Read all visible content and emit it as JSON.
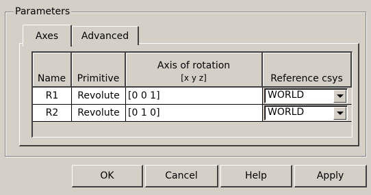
{
  "group": {
    "title": "Parameters"
  },
  "tabs": [
    {
      "label": "Axes",
      "active": true
    },
    {
      "label": "Advanced",
      "active": false
    }
  ],
  "table": {
    "headers": {
      "name": "Name",
      "primitive": "Primitive",
      "axis": "Axis of rotation",
      "axis_sub": "[x y z]",
      "ref": "Reference csys"
    },
    "rows": [
      {
        "name": "R1",
        "primitive": "Revolute",
        "axis": "[0 0 1]",
        "ref": "WORLD"
      },
      {
        "name": "R2",
        "primitive": "Revolute",
        "axis": "[0 1 0]",
        "ref": "WORLD"
      }
    ]
  },
  "buttons": {
    "ok": "OK",
    "cancel": "Cancel",
    "help": "Help",
    "apply": "Apply"
  }
}
